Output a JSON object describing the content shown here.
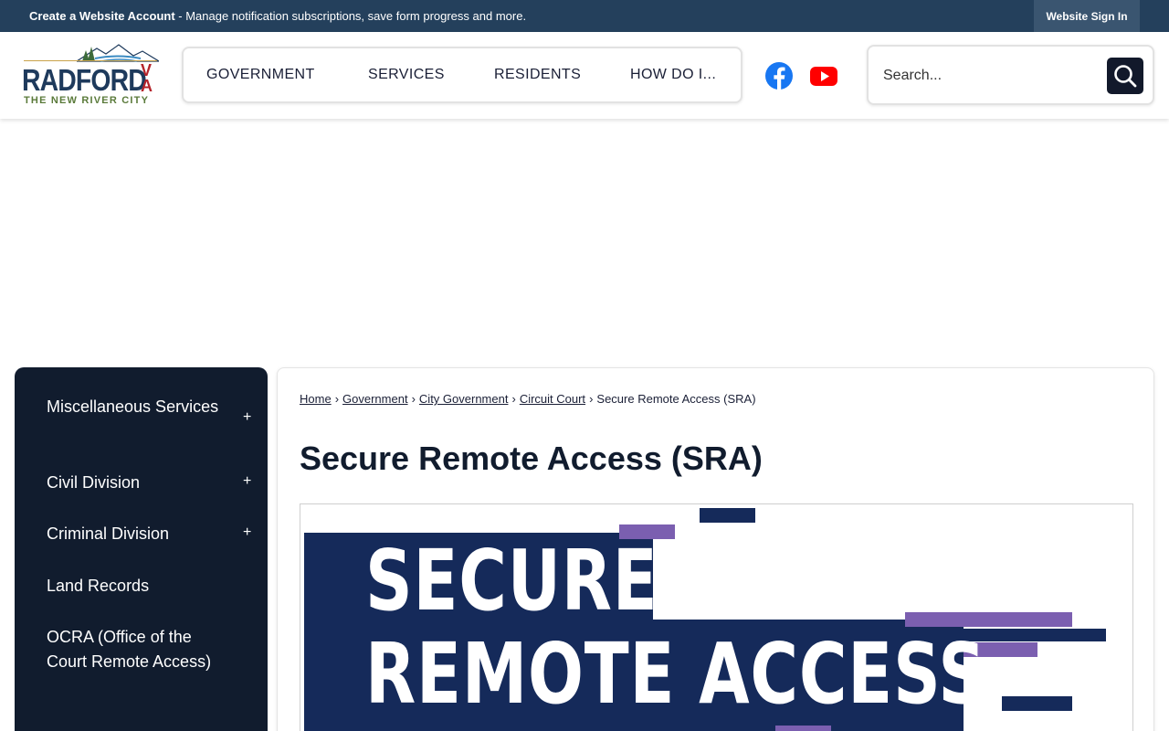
{
  "topbar": {
    "account_link": "Create a Website Account",
    "account_desc": " - Manage notification subscriptions, save form progress and more.",
    "signin_label": "Website Sign In"
  },
  "logo": {
    "wordmark": "RADFORD",
    "state": "VA",
    "tagline": "THE NEW RIVER CITY"
  },
  "nav": {
    "items": [
      "GOVERNMENT",
      "SERVICES",
      "RESIDENTS",
      "HOW DO I..."
    ]
  },
  "social": {
    "facebook": "facebook-icon",
    "youtube": "youtube-icon"
  },
  "search": {
    "placeholder": "Search..."
  },
  "sidebar": {
    "items": [
      {
        "label": "Miscellaneous Services",
        "expandable": "+"
      },
      {
        "label": "Civil Division",
        "expandable": "+"
      },
      {
        "label": "Criminal Division",
        "expandable": "+"
      },
      {
        "label": "Land Records"
      },
      {
        "label": "OCRA (Office of the Court Remote Access)"
      }
    ]
  },
  "breadcrumb": {
    "items": [
      "Home",
      "Government",
      "City Government",
      "Circuit Court"
    ],
    "current": "Secure Remote Access (SRA)"
  },
  "page": {
    "title": "Secure Remote Access (SRA)"
  },
  "banner": {
    "line1": "SECURE",
    "line2": "REMOTE ACCESS"
  },
  "colors": {
    "topbar": "#24405c",
    "sidebar": "#111c2e",
    "banner_navy": "#152a5a",
    "banner_purple": "#7b5fb0",
    "facebook": "#1877f2",
    "youtube": "#ff0000"
  }
}
